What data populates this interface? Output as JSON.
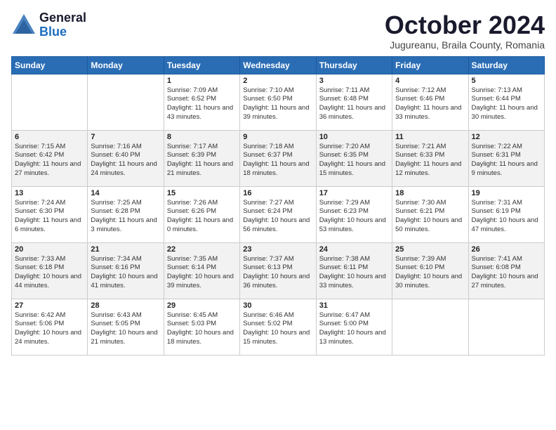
{
  "logo": {
    "general": "General",
    "blue": "Blue"
  },
  "title": "October 2024",
  "subtitle": "Jugureanu, Braila County, Romania",
  "days_of_week": [
    "Sunday",
    "Monday",
    "Tuesday",
    "Wednesday",
    "Thursday",
    "Friday",
    "Saturday"
  ],
  "weeks": [
    [
      {
        "day": "",
        "info": ""
      },
      {
        "day": "",
        "info": ""
      },
      {
        "day": "1",
        "info": "Sunrise: 7:09 AM\nSunset: 6:52 PM\nDaylight: 11 hours and 43 minutes."
      },
      {
        "day": "2",
        "info": "Sunrise: 7:10 AM\nSunset: 6:50 PM\nDaylight: 11 hours and 39 minutes."
      },
      {
        "day": "3",
        "info": "Sunrise: 7:11 AM\nSunset: 6:48 PM\nDaylight: 11 hours and 36 minutes."
      },
      {
        "day": "4",
        "info": "Sunrise: 7:12 AM\nSunset: 6:46 PM\nDaylight: 11 hours and 33 minutes."
      },
      {
        "day": "5",
        "info": "Sunrise: 7:13 AM\nSunset: 6:44 PM\nDaylight: 11 hours and 30 minutes."
      }
    ],
    [
      {
        "day": "6",
        "info": "Sunrise: 7:15 AM\nSunset: 6:42 PM\nDaylight: 11 hours and 27 minutes."
      },
      {
        "day": "7",
        "info": "Sunrise: 7:16 AM\nSunset: 6:40 PM\nDaylight: 11 hours and 24 minutes."
      },
      {
        "day": "8",
        "info": "Sunrise: 7:17 AM\nSunset: 6:39 PM\nDaylight: 11 hours and 21 minutes."
      },
      {
        "day": "9",
        "info": "Sunrise: 7:18 AM\nSunset: 6:37 PM\nDaylight: 11 hours and 18 minutes."
      },
      {
        "day": "10",
        "info": "Sunrise: 7:20 AM\nSunset: 6:35 PM\nDaylight: 11 hours and 15 minutes."
      },
      {
        "day": "11",
        "info": "Sunrise: 7:21 AM\nSunset: 6:33 PM\nDaylight: 11 hours and 12 minutes."
      },
      {
        "day": "12",
        "info": "Sunrise: 7:22 AM\nSunset: 6:31 PM\nDaylight: 11 hours and 9 minutes."
      }
    ],
    [
      {
        "day": "13",
        "info": "Sunrise: 7:24 AM\nSunset: 6:30 PM\nDaylight: 11 hours and 6 minutes."
      },
      {
        "day": "14",
        "info": "Sunrise: 7:25 AM\nSunset: 6:28 PM\nDaylight: 11 hours and 3 minutes."
      },
      {
        "day": "15",
        "info": "Sunrise: 7:26 AM\nSunset: 6:26 PM\nDaylight: 11 hours and 0 minutes."
      },
      {
        "day": "16",
        "info": "Sunrise: 7:27 AM\nSunset: 6:24 PM\nDaylight: 10 hours and 56 minutes."
      },
      {
        "day": "17",
        "info": "Sunrise: 7:29 AM\nSunset: 6:23 PM\nDaylight: 10 hours and 53 minutes."
      },
      {
        "day": "18",
        "info": "Sunrise: 7:30 AM\nSunset: 6:21 PM\nDaylight: 10 hours and 50 minutes."
      },
      {
        "day": "19",
        "info": "Sunrise: 7:31 AM\nSunset: 6:19 PM\nDaylight: 10 hours and 47 minutes."
      }
    ],
    [
      {
        "day": "20",
        "info": "Sunrise: 7:33 AM\nSunset: 6:18 PM\nDaylight: 10 hours and 44 minutes."
      },
      {
        "day": "21",
        "info": "Sunrise: 7:34 AM\nSunset: 6:16 PM\nDaylight: 10 hours and 41 minutes."
      },
      {
        "day": "22",
        "info": "Sunrise: 7:35 AM\nSunset: 6:14 PM\nDaylight: 10 hours and 39 minutes."
      },
      {
        "day": "23",
        "info": "Sunrise: 7:37 AM\nSunset: 6:13 PM\nDaylight: 10 hours and 36 minutes."
      },
      {
        "day": "24",
        "info": "Sunrise: 7:38 AM\nSunset: 6:11 PM\nDaylight: 10 hours and 33 minutes."
      },
      {
        "day": "25",
        "info": "Sunrise: 7:39 AM\nSunset: 6:10 PM\nDaylight: 10 hours and 30 minutes."
      },
      {
        "day": "26",
        "info": "Sunrise: 7:41 AM\nSunset: 6:08 PM\nDaylight: 10 hours and 27 minutes."
      }
    ],
    [
      {
        "day": "27",
        "info": "Sunrise: 6:42 AM\nSunset: 5:06 PM\nDaylight: 10 hours and 24 minutes."
      },
      {
        "day": "28",
        "info": "Sunrise: 6:43 AM\nSunset: 5:05 PM\nDaylight: 10 hours and 21 minutes."
      },
      {
        "day": "29",
        "info": "Sunrise: 6:45 AM\nSunset: 5:03 PM\nDaylight: 10 hours and 18 minutes."
      },
      {
        "day": "30",
        "info": "Sunrise: 6:46 AM\nSunset: 5:02 PM\nDaylight: 10 hours and 15 minutes."
      },
      {
        "day": "31",
        "info": "Sunrise: 6:47 AM\nSunset: 5:00 PM\nDaylight: 10 hours and 13 minutes."
      },
      {
        "day": "",
        "info": ""
      },
      {
        "day": "",
        "info": ""
      }
    ]
  ]
}
